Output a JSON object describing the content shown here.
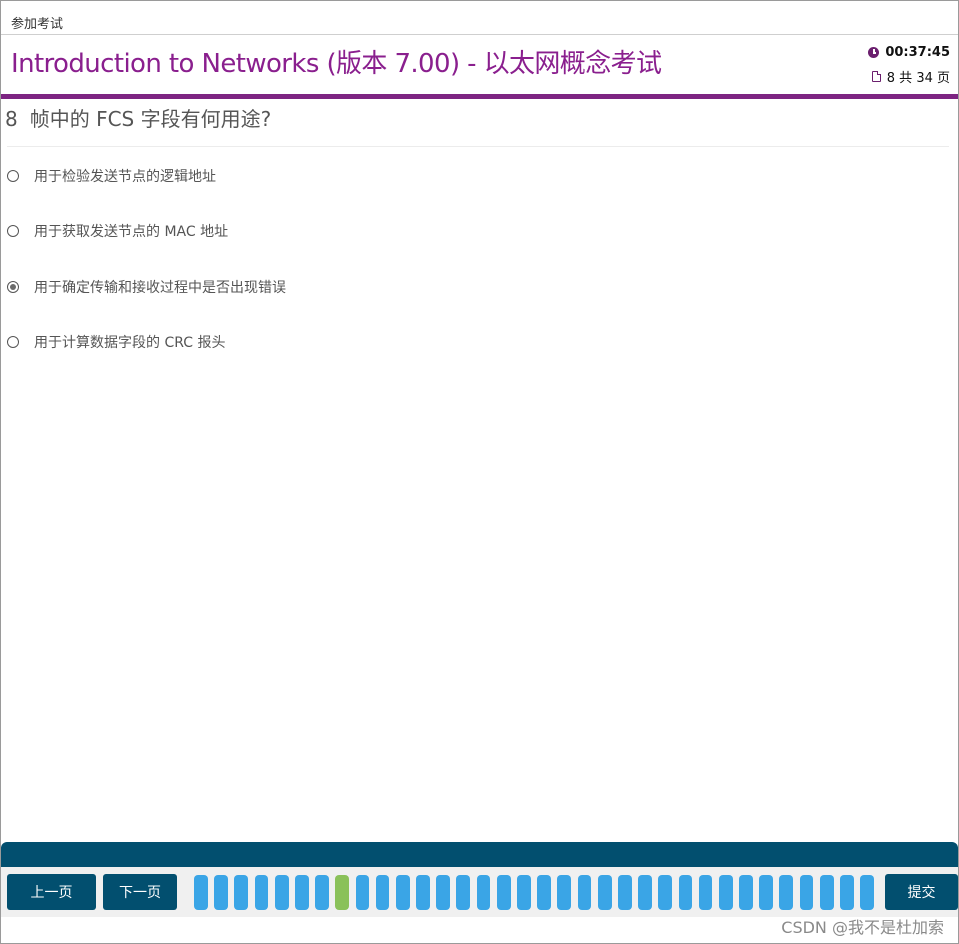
{
  "window": {
    "title": "参加考试"
  },
  "header": {
    "exam_title": "Introduction to Networks (版本 7.00) - 以太网概念考试",
    "timer": "00:37:45",
    "page_indicator": "8 共 34 页",
    "icons": {
      "timer": "clock-icon",
      "pages": "page-icon"
    },
    "accent_color": "#7d2482"
  },
  "question": {
    "number": "8",
    "text": "帧中的 FCS 字段有何用途?",
    "options": [
      {
        "label": "用于检验发送节点的逻辑地址",
        "selected": false
      },
      {
        "label": "用于获取发送节点的 MAC 地址",
        "selected": false
      },
      {
        "label": "用于确定传输和接收过程中是否出现错误",
        "selected": true
      },
      {
        "label": "用于计算数据字段的 CRC 报头",
        "selected": false
      }
    ]
  },
  "navigation": {
    "prev_label": "上一页",
    "next_label": "下一页",
    "submit_label": "提交",
    "total_pages": 34,
    "current_page": 8,
    "colors": {
      "page": "#3aa5e6",
      "current_page": "#8ac159",
      "button": "#024f6f"
    }
  },
  "watermark": "CSDN @我不是杜加索"
}
